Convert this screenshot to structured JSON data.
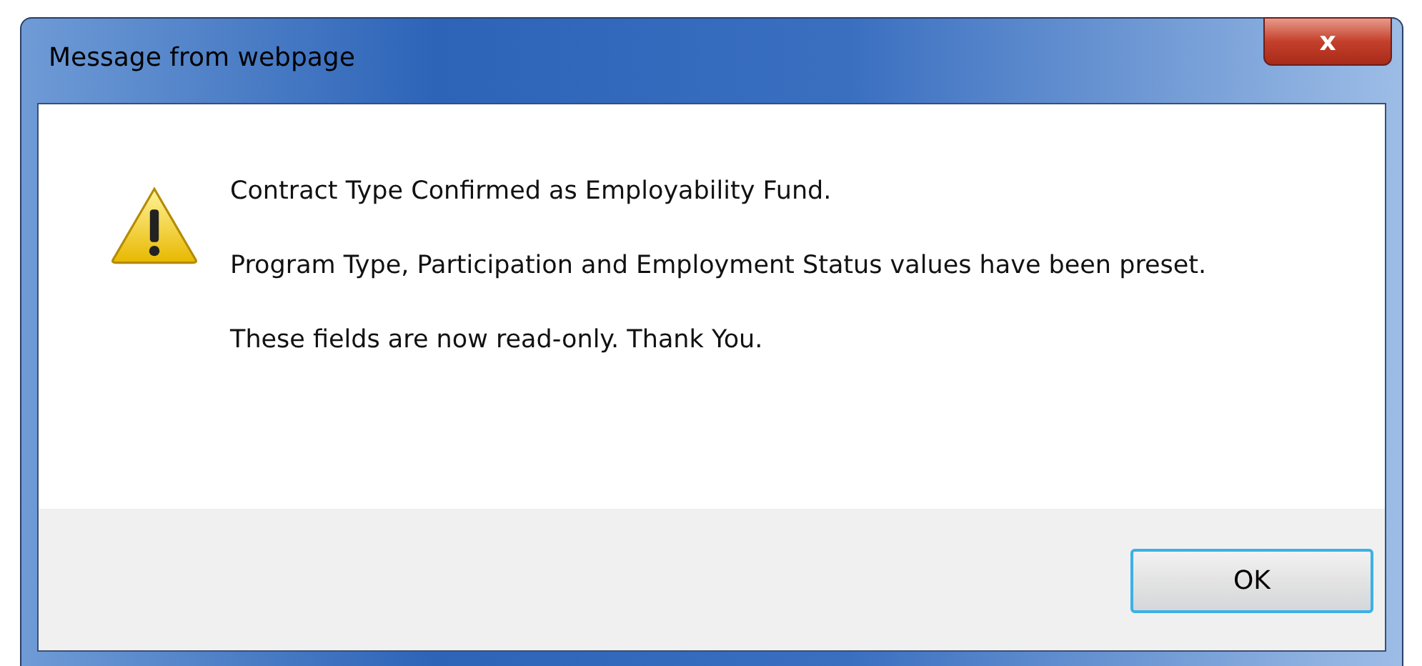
{
  "window": {
    "title": "Message from webpage",
    "close": "x"
  },
  "message": {
    "paragraphs": [
      "Contract Type Confirmed as Employability Fund.",
      "Program Type, Participation and Employment Status values have been preset.",
      "These fields are now read-only. Thank You."
    ]
  },
  "buttons": [
    {
      "label": "OK",
      "selected": true
    }
  ]
}
